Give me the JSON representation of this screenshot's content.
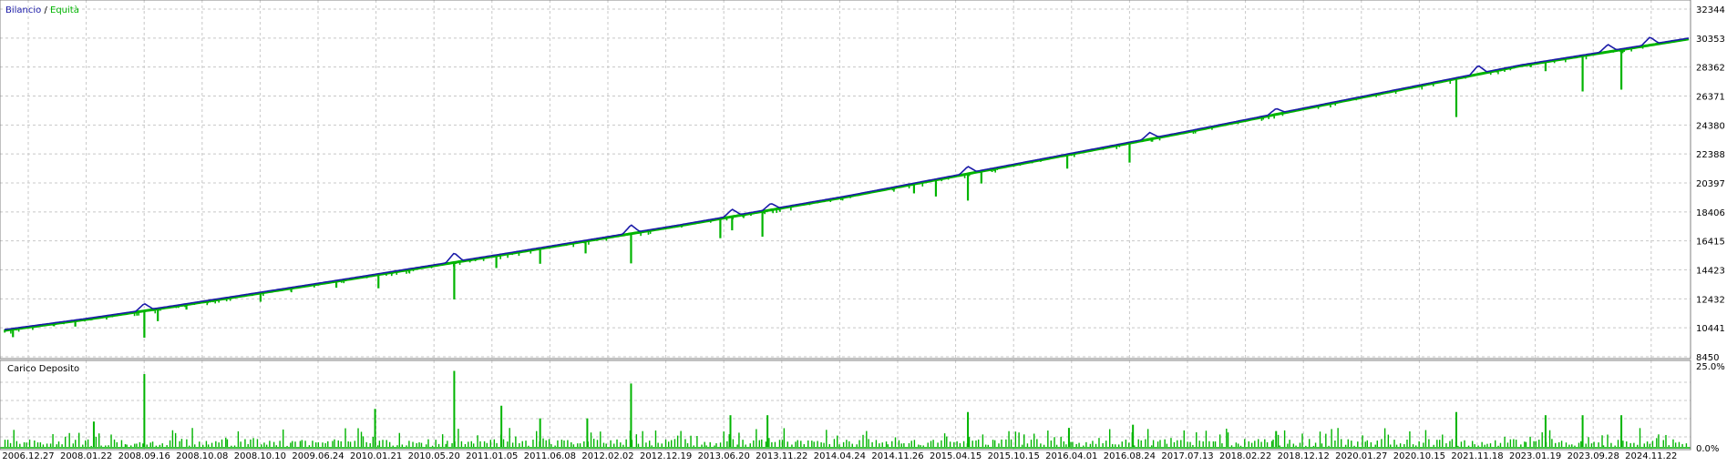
{
  "legend": {
    "balance_label": "Bilancio",
    "separator": " / ",
    "equity_label": "Equità",
    "balance_color": "#1a1aa8",
    "equity_color": "#00b400"
  },
  "load_panel": {
    "title": "Carico Deposito",
    "color": "#00b400"
  },
  "chart_data": [
    {
      "type": "line",
      "title": "",
      "xlabel": "",
      "ylabel": "",
      "ylim": [
        8450,
        32344
      ],
      "yticks": [
        32344,
        30353,
        28362,
        26371,
        24380,
        22388,
        20397,
        18406,
        16415,
        14423,
        12432,
        10441,
        8450
      ],
      "grid": true,
      "legend_placement": "top-left",
      "series": [
        {
          "name": "Bilancio",
          "color": "#1a1aa8",
          "points": [
            [
              0,
              10320
            ],
            [
              0.05,
              11100
            ],
            [
              0.1,
              11950
            ],
            [
              0.2,
              13750
            ],
            [
              0.3,
              15600
            ],
            [
              0.4,
              17500
            ],
            [
              0.5,
              19500
            ],
            [
              0.6,
              21700
            ],
            [
              0.7,
              23900
            ],
            [
              0.8,
              26200
            ],
            [
              0.9,
              28500
            ],
            [
              1.0,
              30350
            ]
          ],
          "bumps": [
            {
              "x": 0.083,
              "dy": 450
            },
            {
              "x": 0.267,
              "dy": 600
            },
            {
              "x": 0.372,
              "dy": 550
            },
            {
              "x": 0.432,
              "dy": 450
            },
            {
              "x": 0.455,
              "dy": 400
            },
            {
              "x": 0.572,
              "dy": 450
            },
            {
              "x": 0.68,
              "dy": 400
            },
            {
              "x": 0.755,
              "dy": 350
            },
            {
              "x": 0.875,
              "dy": 550
            },
            {
              "x": 0.952,
              "dy": 450
            },
            {
              "x": 0.977,
              "dy": 500
            }
          ]
        },
        {
          "name": "Equità",
          "color": "#00b400",
          "dips": [
            {
              "x": 0.005,
              "dy": 600
            },
            {
              "x": 0.042,
              "dy": 450
            },
            {
              "x": 0.083,
              "dy": 1900
            },
            {
              "x": 0.091,
              "dy": 900
            },
            {
              "x": 0.108,
              "dy": 400
            },
            {
              "x": 0.152,
              "dy": 650
            },
            {
              "x": 0.197,
              "dy": 500
            },
            {
              "x": 0.222,
              "dy": 1000
            },
            {
              "x": 0.267,
              "dy": 2600
            },
            {
              "x": 0.292,
              "dy": 900
            },
            {
              "x": 0.318,
              "dy": 1100
            },
            {
              "x": 0.345,
              "dy": 900
            },
            {
              "x": 0.372,
              "dy": 2100
            },
            {
              "x": 0.425,
              "dy": 1400
            },
            {
              "x": 0.432,
              "dy": 1000
            },
            {
              "x": 0.45,
              "dy": 1800
            },
            {
              "x": 0.54,
              "dy": 700
            },
            {
              "x": 0.553,
              "dy": 1200
            },
            {
              "x": 0.572,
              "dy": 1900
            },
            {
              "x": 0.58,
              "dy": 900
            },
            {
              "x": 0.631,
              "dy": 1000
            },
            {
              "x": 0.668,
              "dy": 1400
            },
            {
              "x": 0.862,
              "dy": 2700
            },
            {
              "x": 0.915,
              "dy": 700
            },
            {
              "x": 0.937,
              "dy": 2500
            },
            {
              "x": 0.96,
              "dy": 2800
            }
          ]
        }
      ]
    },
    {
      "type": "bar",
      "title": "Carico Deposito",
      "ylim": [
        0,
        25
      ],
      "yticks": [
        "25.0%",
        "0.0%"
      ],
      "series": [
        {
          "name": "Carico Deposito",
          "spikes": [
            {
              "x": 0.083,
              "value": 23
            },
            {
              "x": 0.267,
              "value": 24
            },
            {
              "x": 0.372,
              "value": 20
            },
            {
              "x": 0.572,
              "value": 11
            },
            {
              "x": 0.862,
              "value": 11
            },
            {
              "x": 0.915,
              "value": 10
            },
            {
              "x": 0.937,
              "value": 10
            },
            {
              "x": 0.96,
              "value": 10
            },
            {
              "x": 0.295,
              "value": 13
            },
            {
              "x": 0.22,
              "value": 12
            },
            {
              "x": 0.431,
              "value": 10
            },
            {
              "x": 0.453,
              "value": 10
            },
            {
              "x": 0.053,
              "value": 8
            },
            {
              "x": 0.318,
              "value": 9
            },
            {
              "x": 0.346,
              "value": 9
            },
            {
              "x": 0.67,
              "value": 7
            },
            {
              "x": 0.632,
              "value": 6
            },
            {
              "x": 0.755,
              "value": 5
            }
          ]
        }
      ]
    }
  ],
  "x_axis": {
    "tick_labels": [
      "2006.12.27",
      "2008.01.22",
      "2008.09.16",
      "2008.10.08",
      "2008.10.10",
      "2009.06.24",
      "2010.01.21",
      "2010.05.20",
      "2011.01.05",
      "2011.06.08",
      "2012.02.02",
      "2012.12.19",
      "2013.06.20",
      "2013.11.22",
      "2014.04.24",
      "2014.11.26",
      "2015.04.15",
      "2015.10.15",
      "2016.04.01",
      "2016.08.24",
      "2017.07.13",
      "2018.02.22",
      "2018.12.12",
      "2020.01.27",
      "2020.10.15",
      "2021.11.18",
      "2023.01.19",
      "2023.09.28",
      "2024.11.22"
    ]
  }
}
